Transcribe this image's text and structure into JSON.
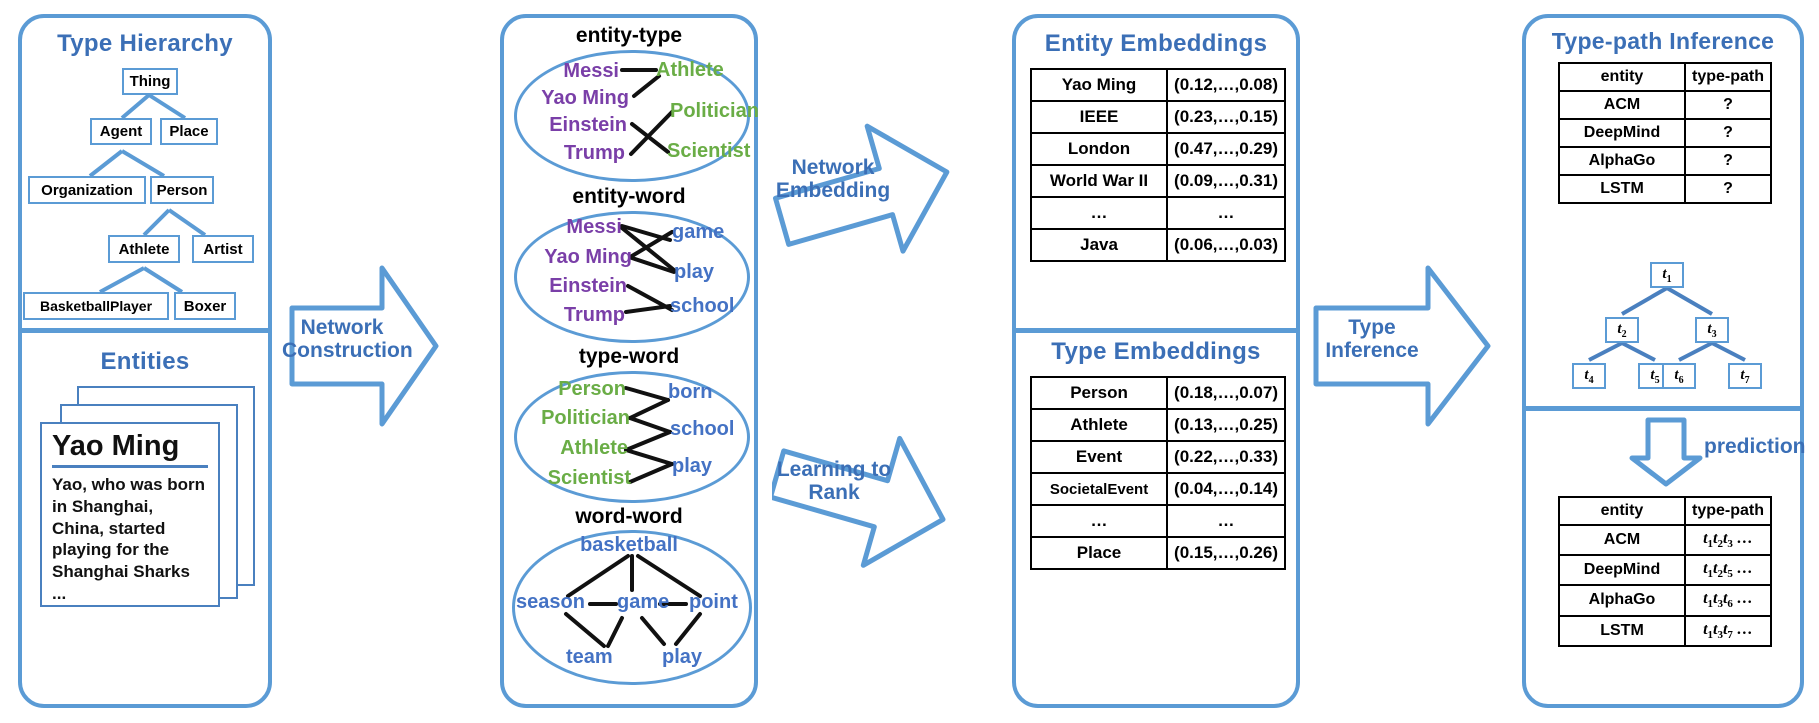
{
  "colors": {
    "accent": "#5b9bd5",
    "title": "#3b6fb6",
    "entity": "#7a3fa8",
    "type": "#6aad46",
    "word": "#4472c4",
    "table_border": "#000000"
  },
  "left_panel": {
    "hierarchy_title": "Type Hierarchy",
    "entities_title": "Entities",
    "hierarchy_nodes": [
      {
        "id": "thing",
        "label": "Thing"
      },
      {
        "id": "agent",
        "label": "Agent"
      },
      {
        "id": "place",
        "label": "Place"
      },
      {
        "id": "organization",
        "label": "Organization"
      },
      {
        "id": "person",
        "label": "Person"
      },
      {
        "id": "athlete",
        "label": "Athlete"
      },
      {
        "id": "artist",
        "label": "Artist"
      },
      {
        "id": "basketballplayer",
        "label": "BasketballPlayer"
      },
      {
        "id": "boxer",
        "label": "Boxer"
      }
    ],
    "hierarchy_edges": [
      [
        "thing",
        "agent"
      ],
      [
        "thing",
        "place"
      ],
      [
        "agent",
        "organization"
      ],
      [
        "agent",
        "person"
      ],
      [
        "person",
        "athlete"
      ],
      [
        "person",
        "artist"
      ],
      [
        "athlete",
        "basketballplayer"
      ],
      [
        "athlete",
        "boxer"
      ]
    ],
    "entity_card": {
      "title": "Yao Ming",
      "body": "Yao, who was born in Shanghai, China, started playing for the Shanghai Sharks ..."
    }
  },
  "arrows": {
    "network_construction": "Network\nConstruction",
    "network_construction_line1": "Network",
    "network_construction_line2": "Construction",
    "network_embedding_line1": "Network",
    "network_embedding_line2": "Embedding",
    "learning_to_rank_line1": "Learning to",
    "learning_to_rank_line2": "Rank",
    "type_inference_line1": "Type",
    "type_inference_line2": "Inference",
    "prediction": "prediction"
  },
  "networks": [
    {
      "label": "entity-type",
      "left_nodes": [
        "Messi",
        "Yao Ming",
        "Einstein",
        "Trump"
      ],
      "left_color": "entity",
      "right_nodes": [
        "Athlete",
        "Politician",
        "Scientist"
      ],
      "right_color": "type",
      "edges": [
        [
          0,
          0
        ],
        [
          1,
          0
        ],
        [
          2,
          2
        ],
        [
          3,
          1
        ]
      ]
    },
    {
      "label": "entity-word",
      "left_nodes": [
        "Messi",
        "Yao Ming",
        "Einstein",
        "Trump"
      ],
      "left_color": "entity",
      "right_nodes": [
        "game",
        "play",
        "school"
      ],
      "right_color": "word",
      "edges": [
        [
          0,
          0
        ],
        [
          0,
          1
        ],
        [
          1,
          0
        ],
        [
          1,
          1
        ],
        [
          2,
          2
        ],
        [
          3,
          2
        ]
      ]
    },
    {
      "label": "type-word",
      "left_nodes": [
        "Person",
        "Politician",
        "Athlete",
        "Scientist"
      ],
      "left_color": "type",
      "right_nodes": [
        "born",
        "school",
        "play"
      ],
      "right_color": "word",
      "edges": [
        [
          0,
          0
        ],
        [
          1,
          0
        ],
        [
          1,
          1
        ],
        [
          2,
          1
        ],
        [
          2,
          2
        ],
        [
          3,
          0
        ],
        [
          3,
          2
        ]
      ]
    },
    {
      "label": "word-word",
      "nodes": [
        "basketball",
        "season",
        "game",
        "point",
        "team",
        "play"
      ],
      "color": "word",
      "edges": [
        [
          "basketball",
          "season"
        ],
        [
          "basketball",
          "game"
        ],
        [
          "basketball",
          "point"
        ],
        [
          "season",
          "game"
        ],
        [
          "game",
          "point"
        ],
        [
          "season",
          "team"
        ],
        [
          "game",
          "team"
        ],
        [
          "game",
          "play"
        ],
        [
          "point",
          "play"
        ]
      ]
    }
  ],
  "embeddings": {
    "entity_title": "Entity Embeddings",
    "entity_rows": [
      [
        "Yao Ming",
        "(0.12,…,0.08)"
      ],
      [
        "IEEE",
        "(0.23,…,0.15)"
      ],
      [
        "London",
        "(0.47,…,0.29)"
      ],
      [
        "World War II",
        "(0.09,…,0.31)"
      ],
      [
        "…",
        "…"
      ],
      [
        "Java",
        "(0.06,…,0.03)"
      ]
    ],
    "type_title": "Type Embeddings",
    "type_rows": [
      [
        "Person",
        "(0.18,…,0.07)"
      ],
      [
        "Athlete",
        "(0.13,…,0.25)"
      ],
      [
        "Event",
        "(0.22,…,0.33)"
      ],
      [
        "SocietalEvent",
        "(0.04,…,0.14)"
      ],
      [
        "…",
        "…"
      ],
      [
        "Place",
        "(0.15,…,0.26)"
      ]
    ]
  },
  "inference": {
    "title": "Type-path Inference",
    "query_headers": [
      "entity",
      "type-path"
    ],
    "query_rows": [
      [
        "ACM",
        "?"
      ],
      [
        "DeepMind",
        "?"
      ],
      [
        "AlphaGo",
        "?"
      ],
      [
        "LSTM",
        "?"
      ]
    ],
    "tree_nodes": [
      {
        "id": "t1",
        "label": "t",
        "sub": "1"
      },
      {
        "id": "t2",
        "label": "t",
        "sub": "2"
      },
      {
        "id": "t3",
        "label": "t",
        "sub": "3"
      },
      {
        "id": "t4",
        "label": "t",
        "sub": "4"
      },
      {
        "id": "t5",
        "label": "t",
        "sub": "5"
      },
      {
        "id": "t6",
        "label": "t",
        "sub": "6"
      },
      {
        "id": "t7",
        "label": "t",
        "sub": "7"
      }
    ],
    "tree_edges": [
      [
        "t1",
        "t2"
      ],
      [
        "t1",
        "t3"
      ],
      [
        "t2",
        "t4"
      ],
      [
        "t2",
        "t5"
      ],
      [
        "t3",
        "t6"
      ],
      [
        "t3",
        "t7"
      ]
    ],
    "result_headers": [
      "entity",
      "type-path"
    ],
    "result_rows": [
      {
        "entity": "ACM",
        "path": [
          "1",
          "2",
          "3"
        ]
      },
      {
        "entity": "DeepMind",
        "path": [
          "1",
          "2",
          "5"
        ]
      },
      {
        "entity": "AlphaGo",
        "path": [
          "1",
          "3",
          "6"
        ]
      },
      {
        "entity": "LSTM",
        "path": [
          "1",
          "3",
          "7"
        ]
      }
    ],
    "path_suffix": "…"
  }
}
